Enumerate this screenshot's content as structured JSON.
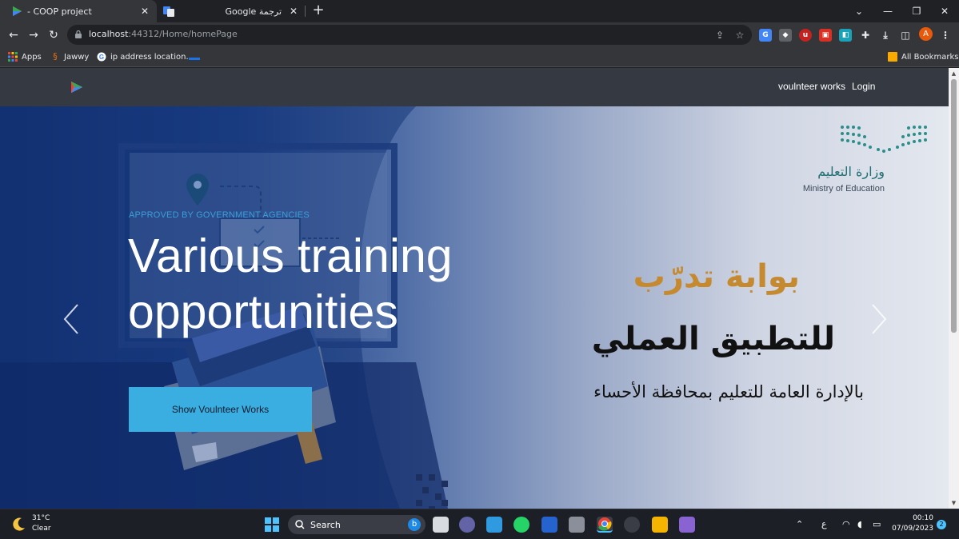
{
  "browser": {
    "tabs": [
      {
        "title": "- COOP project",
        "close": "✕",
        "active": true
      },
      {
        "title": "Google ترجمة",
        "close": "✕",
        "active": false
      }
    ],
    "new_tab": "+",
    "window_controls": {
      "dropdown": "⌄",
      "minimize": "—",
      "restore": "❐",
      "close": "✕"
    },
    "toolbar": {
      "back": "←",
      "forward": "→",
      "reload": "↻",
      "url_host": "localhost",
      "url_rest": ":44312/Home/homePage",
      "profile_initial": "A"
    },
    "bookmarks": [
      {
        "label": "Apps",
        "icon": "apps-grid-icon"
      },
      {
        "label": "Jawwy",
        "icon": "jawwy-icon"
      },
      {
        "label": "ip address location...",
        "icon": "google-icon"
      }
    ],
    "all_bookmarks": "All Bookmarks"
  },
  "site": {
    "nav_links": [
      "voulnteer works",
      "Login"
    ],
    "hero": {
      "eyebrow": "APPROVED BY GOVERNMENT AGENCIES",
      "headline": "Various training opportunities",
      "cta": "Show Voulnteer Works",
      "ar_title": "بوابة تدرّب",
      "ar_subtitle": "للتطبيق العملي",
      "ar_line": "بالإدارة العامة للتعليم بمحافظة الأحساء",
      "ministry_ar": "وزارة التعليم",
      "ministry_en": "Ministry of Education"
    },
    "colors": {
      "nav_bg": "#353a42",
      "cta_bg": "#3aaee0",
      "eyebrow": "#3aa0d8",
      "ar_title": "#c58a2f"
    }
  },
  "taskbar": {
    "weather_temp": "31°C",
    "weather_condition": "Clear",
    "search_label": "Search",
    "tray_lang": "ع",
    "time": "00:10",
    "date": "07/09/2023",
    "notification_count": "2"
  }
}
